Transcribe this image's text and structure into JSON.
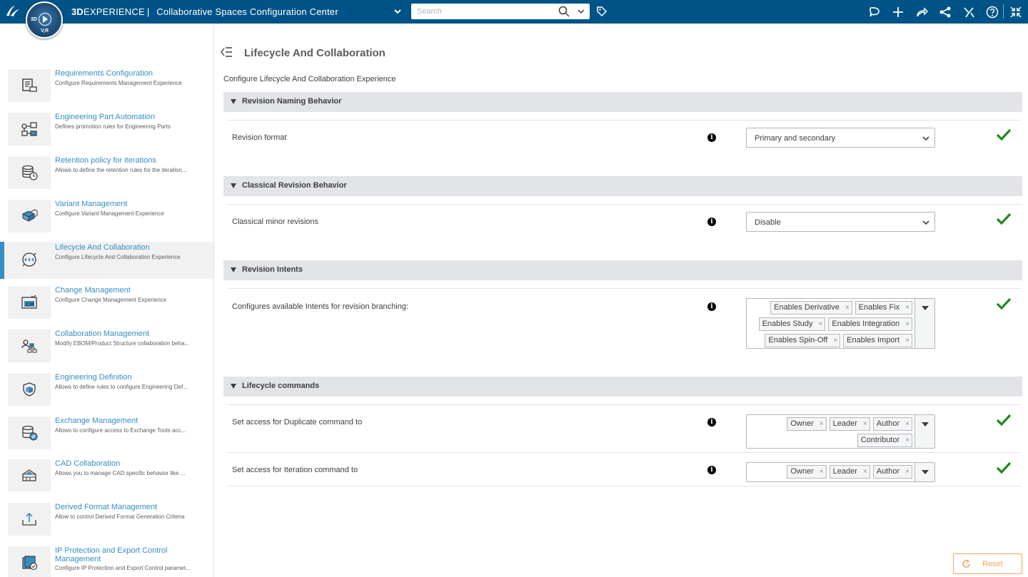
{
  "topbar": {
    "brand_bold": "3D",
    "brand_rest": "EXPERIENCE",
    "separator": "|",
    "app_title": "Collaborative Spaces Configuration Center",
    "search_placeholder": "Search",
    "compass_labels": [
      "3D",
      "V,R"
    ],
    "icons": [
      "ds-logo-icon",
      "compass-icon",
      "chevron-down-icon",
      "search-icon",
      "tag-icon",
      "chat-icon",
      "plus-icon",
      "share-arrow-icon",
      "network-share-icon",
      "tools-icon",
      "help-icon",
      "fullscreen-icon"
    ],
    "color": "#005386"
  },
  "sidebar": {
    "accent": "#368ec4",
    "items": [
      {
        "title": "Requirements Configuration",
        "desc": "Configure Requirements Management Experience",
        "icon": "requirements-icon"
      },
      {
        "title": "Engineering Part Automation",
        "desc": "Defines promotion rules for Engineering Parts",
        "icon": "part-automation-icon"
      },
      {
        "title": "Retention policy for iterations",
        "desc": "Allows to define the retention rules for the iteration...",
        "icon": "retention-icon"
      },
      {
        "title": "Variant Management",
        "desc": "Configure Variant Management Experience",
        "icon": "variant-icon"
      },
      {
        "title": "Lifecycle And Collaboration",
        "desc": "Configure Lifecycle And Collaboration Experience",
        "icon": "lifecycle-icon",
        "active": true
      },
      {
        "title": "Change Management",
        "desc": "Configure Change Management Experience",
        "icon": "change-management-icon"
      },
      {
        "title": "Collaboration Management",
        "desc": "Modify EBOM/Product Structure collaboration beha...",
        "icon": "collaboration-icon"
      },
      {
        "title": "Engineering Definition",
        "desc": "Allows to define rules to configure Engineering Def...",
        "icon": "engineering-definition-icon"
      },
      {
        "title": "Exchange Management",
        "desc": "Allows to configure access to Exchange Tools acc...",
        "icon": "exchange-icon"
      },
      {
        "title": "CAD Collaboration",
        "desc": "Allows you to manage CAD specific behavior like ...",
        "icon": "cad-icon"
      },
      {
        "title": "Derived Format Management",
        "desc": "Allow to control Derived Format Generation Criteria",
        "icon": "derived-format-icon"
      },
      {
        "title": "IP Protection and Export Control Management",
        "desc": "Configure IP Protection and Export Control paramet...",
        "icon": "ip-protection-icon"
      }
    ]
  },
  "main": {
    "title": "Lifecycle And Collaboration",
    "description": "Configure Lifecycle And Collaboration Experience",
    "sections": [
      {
        "label": "Revision Naming Behavior",
        "rows": [
          {
            "label": "Revision format",
            "type": "select",
            "value": "Primary and secondary"
          }
        ]
      },
      {
        "label": "Classical Revision Behavior",
        "rows": [
          {
            "label": "Classical minor revisions",
            "type": "select",
            "value": "Disable"
          }
        ]
      },
      {
        "label": "Revision Intents",
        "rows": [
          {
            "label": "Configures available Intents for revision branching:",
            "type": "multi",
            "values": [
              "Enables Derivative",
              "Enables Fix",
              "Enables Study",
              "Enables Integration",
              "Enables Spin-Off",
              "Enables Import"
            ]
          }
        ]
      },
      {
        "label": "Lifecycle commands",
        "rows": [
          {
            "label": "Set access for Duplicate command to",
            "type": "multi",
            "values": [
              "Owner",
              "Leader",
              "Author",
              "Contributor"
            ]
          },
          {
            "label": "Set access for Iteration command to",
            "type": "multi",
            "values": [
              "Owner",
              "Leader",
              "Author"
            ]
          }
        ]
      }
    ],
    "tag_remove": "×",
    "info_glyph": "i",
    "check_color": "#1e8a1e",
    "reset_label": "Reset",
    "reset_color": "#f5a463"
  }
}
